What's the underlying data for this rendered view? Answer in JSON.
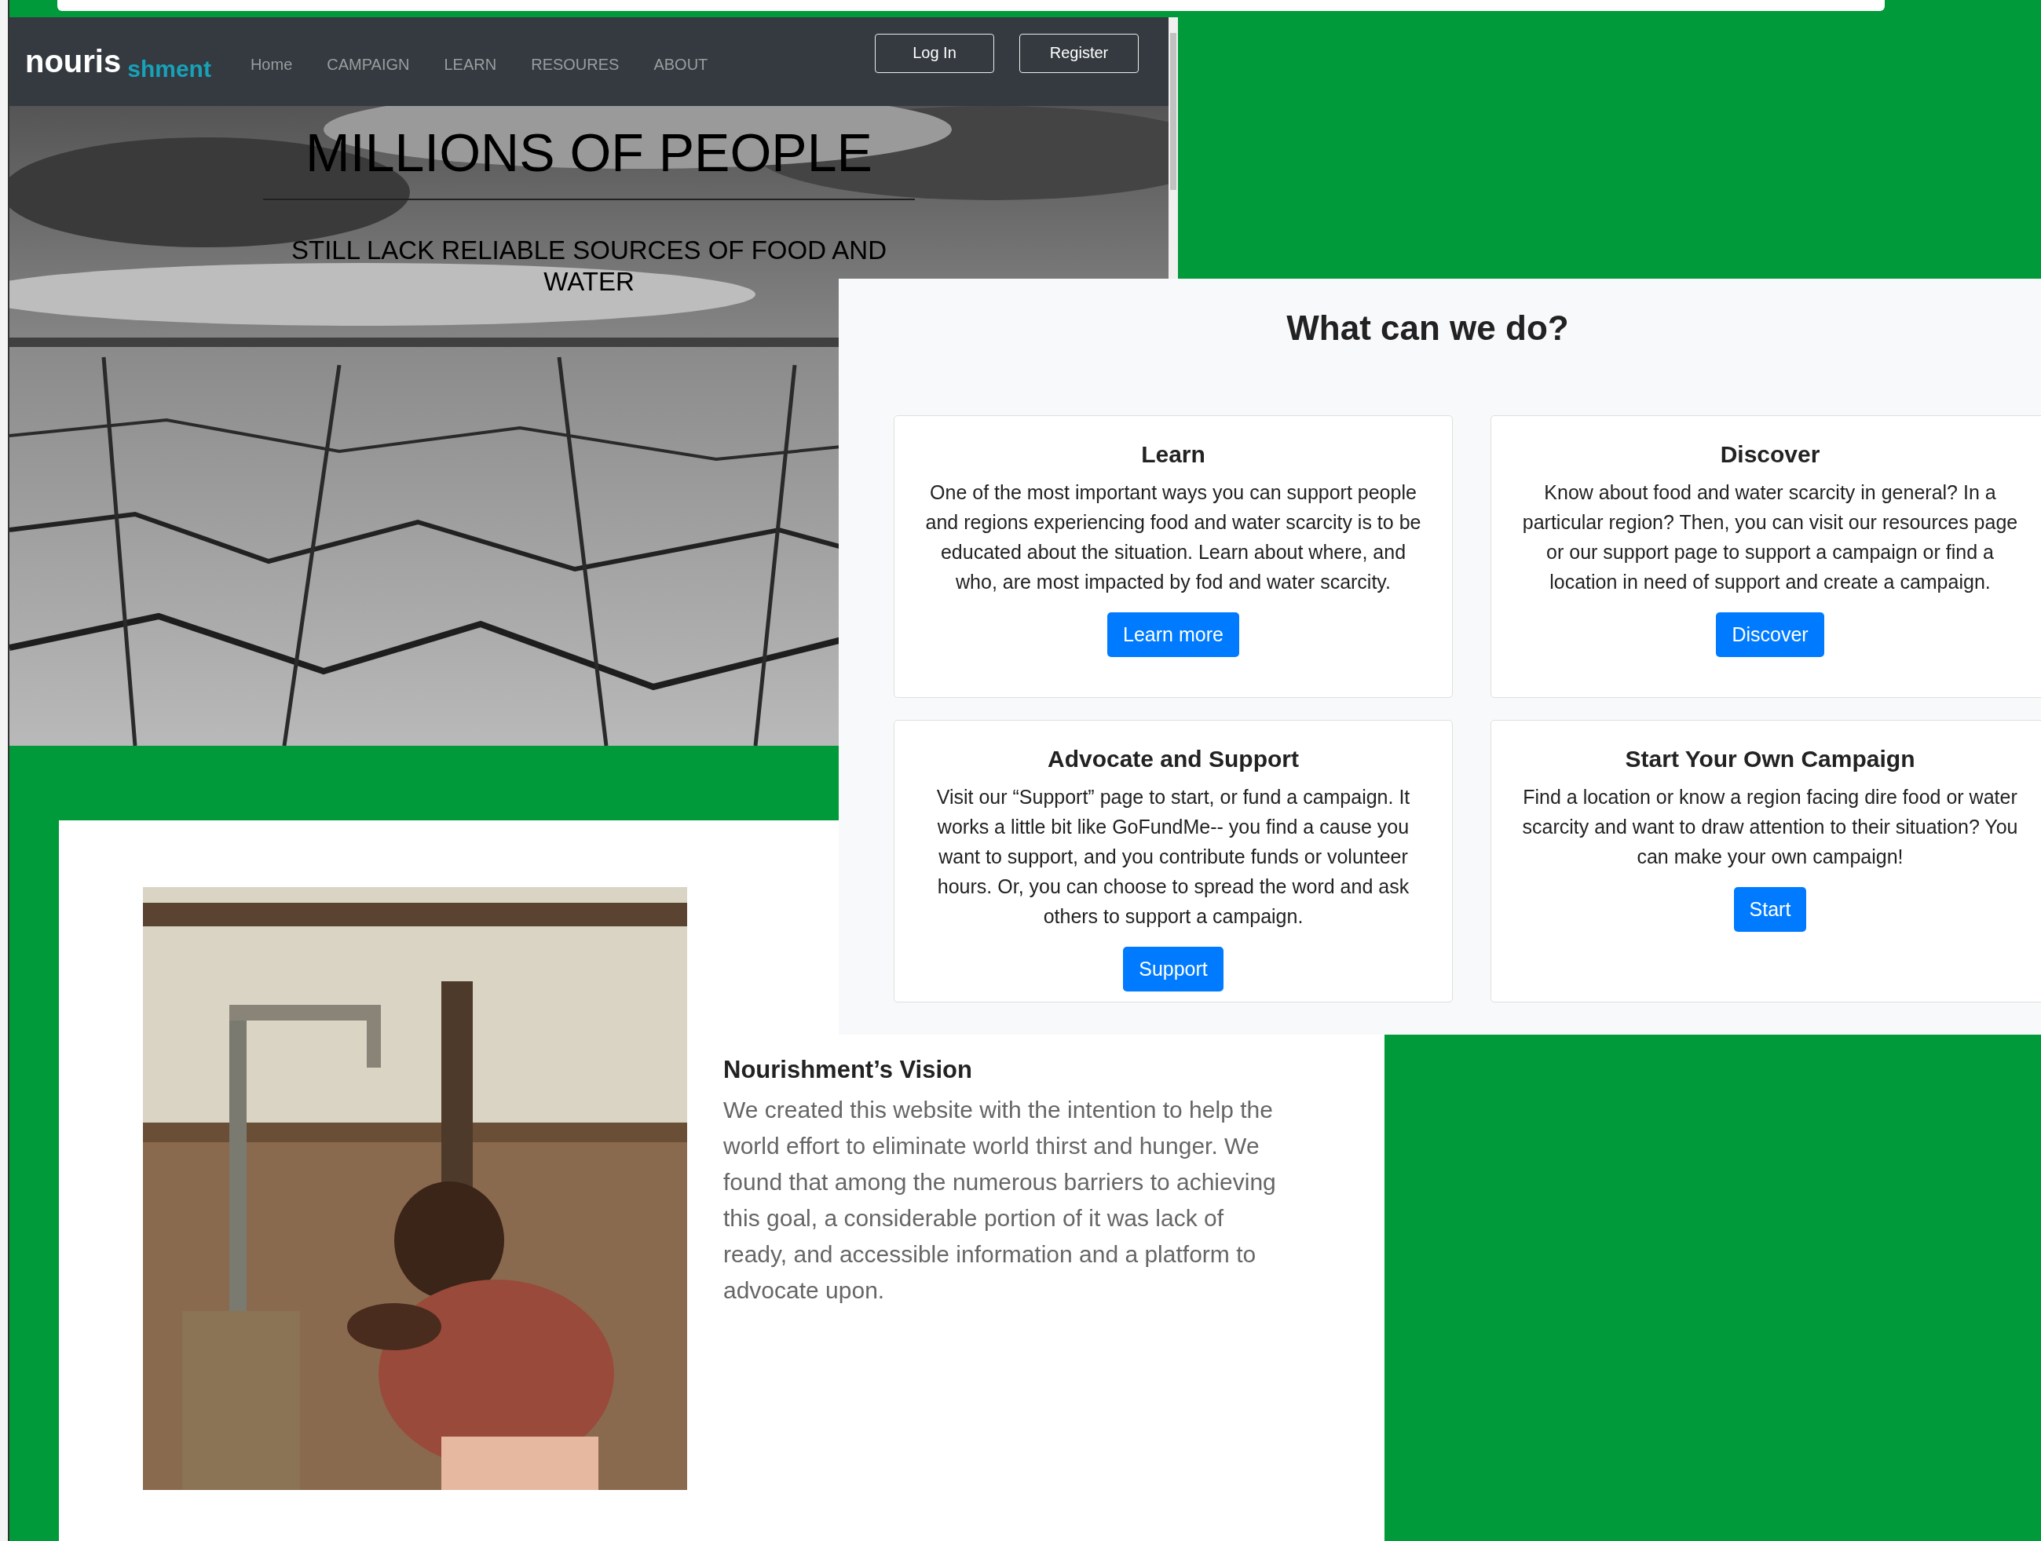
{
  "hero_page": {
    "navbar": {
      "logo": [
        "nouris",
        "shment"
      ],
      "links": [
        "Home",
        "CAMPAIGN",
        "LEARN",
        "RESOURES",
        "ABOUT"
      ],
      "buttons": [
        "Log In",
        "Register"
      ]
    },
    "hero": {
      "title": "MILLIONS OF PEOPLE",
      "subtitle": "STILL LACK RELIABLE SOURCES OF FOOD AND WATER"
    }
  },
  "actions_page": {
    "title": "What can we do?",
    "cards": [
      {
        "title": "Learn",
        "text": "One of the most important ways you can support people and regions experiencing food and water scarcity is to be educated about the situation. Learn about where, and who, are most impacted by fod and water scarcity.",
        "button": "Learn more"
      },
      {
        "title": "Discover",
        "text": "Know about food and water scarcity in general? In a particular region? Then, you can visit our resources page or our support page to support a campaign or find a location in need of support and create a campaign.",
        "button": "Discover"
      },
      {
        "title": "Advocate and Support",
        "text": "Visit our “Support” page to start, or fund a campaign. It works a little bit like GoFundMe-- you find a cause you want to support, and you contribute funds or volunteer hours. Or, you can choose to spread the word and ask others to support a campaign.",
        "button": "Support"
      },
      {
        "title": "Start Your Own Campaign",
        "text": "Find a location or know a region facing dire food or water scarcity and want to draw attention to their situation? You can make your own campaign!",
        "button": "Start"
      }
    ]
  },
  "vision_page": {
    "heading": "Nourishment’s Vision",
    "text": "We created this website with the intention to help the world effort to eliminate world thirst and hunger. We found that among the numerous barriers to achieving this goal, a considerable portion of it was lack of ready, and accessible information and a platform to advocate upon."
  }
}
